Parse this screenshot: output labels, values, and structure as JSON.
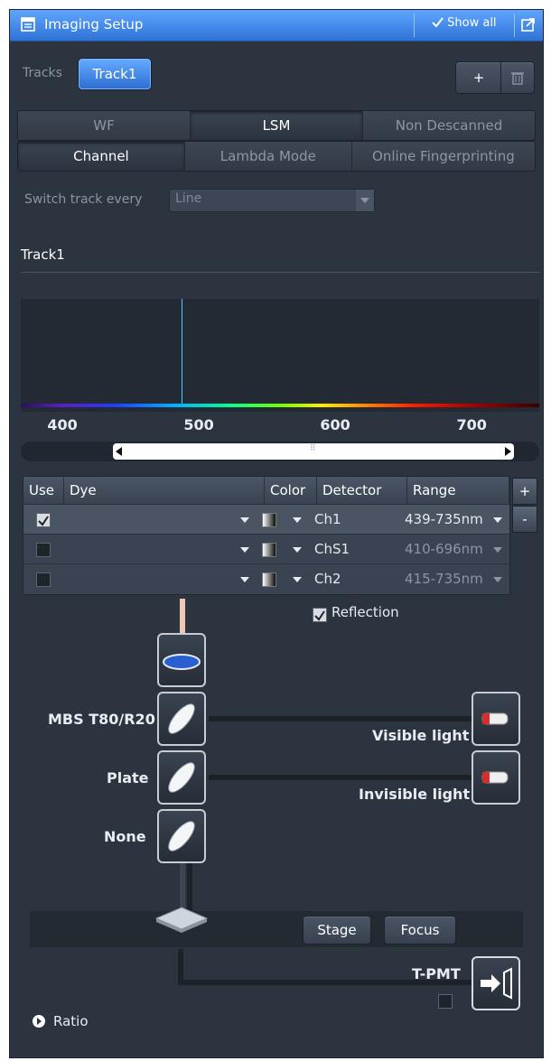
{
  "titlebar": {
    "title": "Imaging Setup",
    "show_all": "Show all"
  },
  "tracks": {
    "label": "Tracks",
    "active": "Track1",
    "add": "+",
    "delete_icon": "trash-icon"
  },
  "mode_tabs": [
    "WF",
    "LSM",
    "Non Descanned"
  ],
  "mode_active": "LSM",
  "sub_tabs": [
    "Channel",
    "Lambda Mode",
    "Online Fingerprinting"
  ],
  "sub_active": "Channel",
  "switch_track": {
    "label": "Switch track every",
    "value": "Line"
  },
  "section_title": "Track1",
  "spectrum": {
    "ticks": [
      "400",
      "500",
      "600",
      "700"
    ],
    "laser_line_nm": 488,
    "range_nm": [
      370,
      750
    ]
  },
  "channel_table": {
    "headers": {
      "use": "Use",
      "dye": "Dye",
      "color": "Color",
      "detector": "Detector",
      "range": "Range"
    },
    "add": "+",
    "remove": "-",
    "rows": [
      {
        "use": true,
        "dye": "",
        "detector": "Ch1",
        "range": "439-735nm"
      },
      {
        "use": false,
        "dye": "",
        "detector": "ChS1",
        "range": "410-696nm"
      },
      {
        "use": false,
        "dye": "",
        "detector": "Ch2",
        "range": "415-735nm"
      }
    ]
  },
  "reflection": {
    "label": "Reflection",
    "checked": true
  },
  "light_path": {
    "mbs": "MBS T80/R20",
    "plate": "Plate",
    "none": "None",
    "visible": "Visible light",
    "invisible": "Invisible light",
    "stage": "Stage",
    "focus": "Focus",
    "tpmt": "T-PMT",
    "tpmt_checked": false
  },
  "ratio": {
    "label": "Ratio"
  },
  "colors": {
    "accent": "#3b82e8",
    "panel": "#2c3440",
    "laser": "#3ad0ff"
  }
}
